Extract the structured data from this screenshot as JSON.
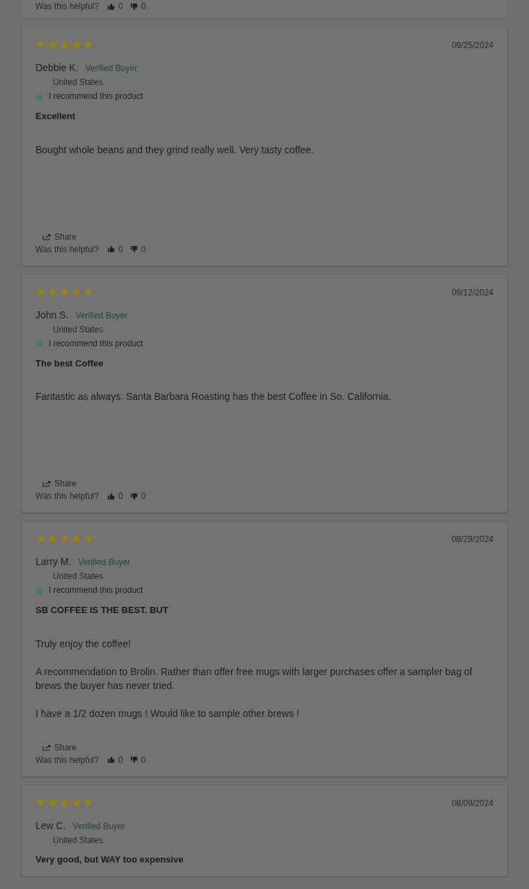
{
  "top_card": {
    "helpful_label": "Was this helpful?",
    "up": "0",
    "down": "0"
  },
  "reviews": [
    {
      "stars": 5,
      "date": "09/25/2024",
      "name": "Debbie K.",
      "badge": "Verified Buyer",
      "country": "United States",
      "recommend": "I recommend this product",
      "title": "Excellent",
      "body": [
        "Bought whole beans and they grind really well. Very tasty coffee."
      ],
      "share": "Share",
      "helpful_label": "Was this helpful?",
      "up": "0",
      "down": "0"
    },
    {
      "stars": 5,
      "date": "09/12/2024",
      "name": "John S.",
      "badge": "Verified Buyer",
      "country": "United States",
      "recommend": "I recommend this product",
      "title": "The best Coffee",
      "body": [
        "Fantastic as always. Santa Barbara Roasting has the best Coffee in So. California."
      ],
      "share": "Share",
      "helpful_label": "Was this helpful?",
      "up": "0",
      "down": "0"
    },
    {
      "stars": 5,
      "date": "08/29/2024",
      "name": "Larry M.",
      "badge": "Verified Buyer",
      "country": "United States",
      "recommend": "I recommend this product",
      "title": "SB COFFEE IS THE BEST. BUT",
      "body": [
        "Truly enjoy the coffee!",
        "A recommendation to Brolin. Rather than offer free mugs with larger purchases offer a sampler bag of brews the buyer has never tried.",
        "I have a 1/2 dozen mugs ! Would like to sample other brews !"
      ],
      "share": "Share",
      "helpful_label": "Was this helpful?",
      "up": "0",
      "down": "0"
    },
    {
      "stars": 5,
      "date": "08/09/2024",
      "name": "Lew C.",
      "badge": "Verified Buyer",
      "country": "United States",
      "title": "Very good, but WAY too expensive"
    }
  ]
}
